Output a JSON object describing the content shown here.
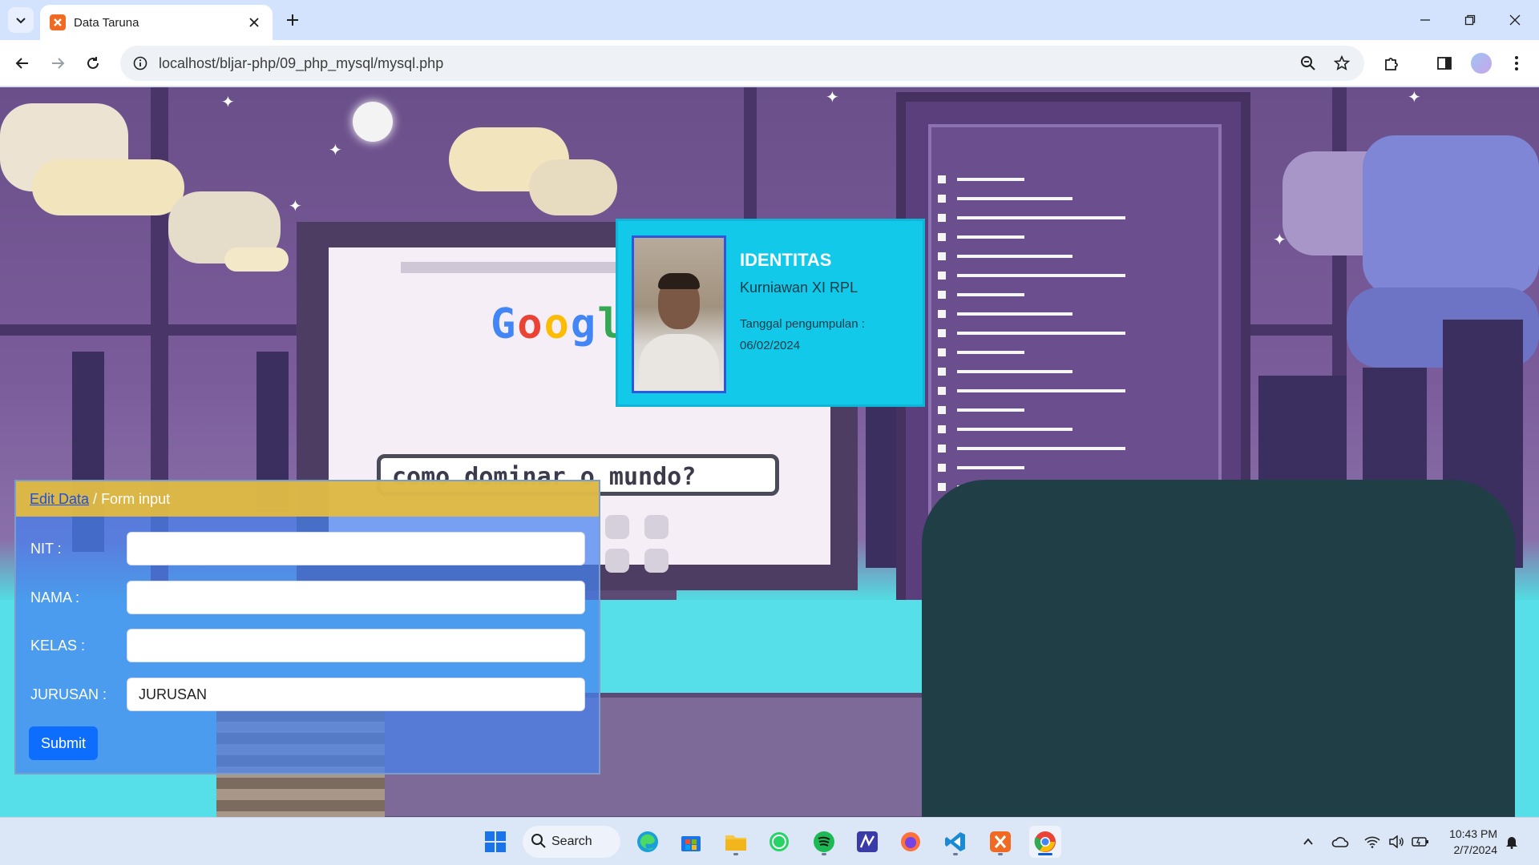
{
  "browser": {
    "tab_title": "Data Taruna",
    "url": "localhost/bljar-php/09_php_mysql/mysql.php"
  },
  "identity": {
    "title": "IDENTITAS",
    "name": "Kurniawan XI RPL",
    "date_label": "Tanggal pengumpulan :",
    "date_value": "06/02/2024"
  },
  "form": {
    "breadcrumb_link": "Edit Data",
    "breadcrumb_separator": "/",
    "breadcrumb_current": "Form input",
    "fields": [
      {
        "label": "NIT :",
        "value": "",
        "placeholder": ""
      },
      {
        "label": "NAMA :",
        "value": "",
        "placeholder": ""
      },
      {
        "label": "KELAS :",
        "value": "",
        "placeholder": ""
      },
      {
        "label": "JURUSAN :",
        "value": "JURUSAN",
        "placeholder": ""
      }
    ],
    "submit_label": "Submit"
  },
  "background": {
    "logo_text": "Google",
    "search_text": "como dominar o mundo?"
  },
  "taskbar": {
    "search_label": "Search",
    "time": "10:43 PM",
    "date": "2/7/2024"
  },
  "colors": {
    "card_accent": "#12c9ea",
    "form_header": "#e6bc3c",
    "submit": "#0d6efd"
  }
}
